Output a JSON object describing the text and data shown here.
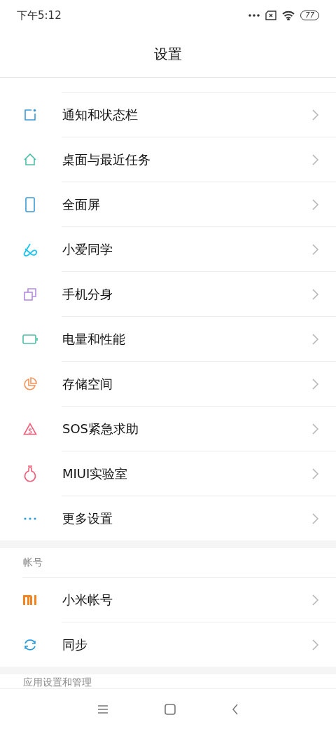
{
  "status_bar": {
    "time": "下午5:12",
    "battery": "77"
  },
  "title": "设置",
  "sections": [
    {
      "items": [
        {
          "label": "通知和状态栏",
          "kind": "notification"
        },
        {
          "label": "桌面与最近任务",
          "kind": "home"
        },
        {
          "label": "全面屏",
          "kind": "phone"
        },
        {
          "label": "小爱同学",
          "kind": "assistant"
        },
        {
          "label": "手机分身",
          "kind": "clone"
        },
        {
          "label": "电量和性能",
          "kind": "battery"
        },
        {
          "label": "存储空间",
          "kind": "storage"
        },
        {
          "label": "SOS紧急求助",
          "kind": "sos"
        },
        {
          "label": "MIUI实验室",
          "kind": "lab"
        },
        {
          "label": "更多设置",
          "kind": "more"
        }
      ]
    },
    {
      "header": "帐号",
      "items": [
        {
          "label": "小米帐号",
          "kind": "mi"
        },
        {
          "label": "同步",
          "kind": "sync"
        }
      ]
    },
    {
      "header": "应用设置和管理"
    }
  ]
}
